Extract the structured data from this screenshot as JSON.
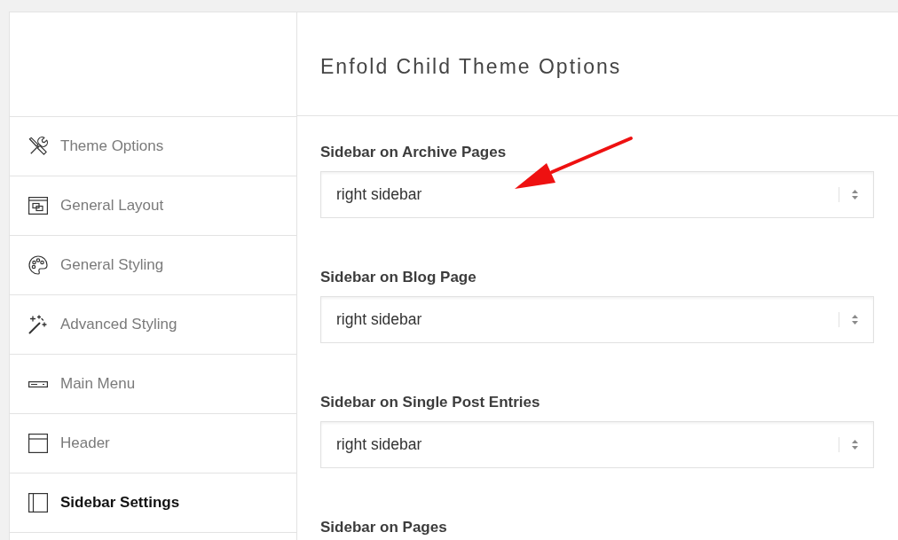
{
  "sidebar": {
    "items": [
      {
        "label": "Theme Options",
        "selected": false
      },
      {
        "label": "General Layout",
        "selected": false
      },
      {
        "label": "General Styling",
        "selected": false
      },
      {
        "label": "Advanced Styling",
        "selected": false
      },
      {
        "label": "Main Menu",
        "selected": false
      },
      {
        "label": "Header",
        "selected": false
      },
      {
        "label": "Sidebar Settings",
        "selected": true
      }
    ]
  },
  "page_title": "Enfold Child Theme Options",
  "settings": [
    {
      "label": "Sidebar on Archive Pages",
      "value": "right sidebar",
      "pointer_arrow": true
    },
    {
      "label": "Sidebar on Blog Page",
      "value": "right sidebar",
      "pointer_arrow": false
    },
    {
      "label": "Sidebar on Single Post Entries",
      "value": "right sidebar",
      "pointer_arrow": false
    },
    {
      "label": "Sidebar on Pages",
      "pointer_arrow": false
    }
  ]
}
